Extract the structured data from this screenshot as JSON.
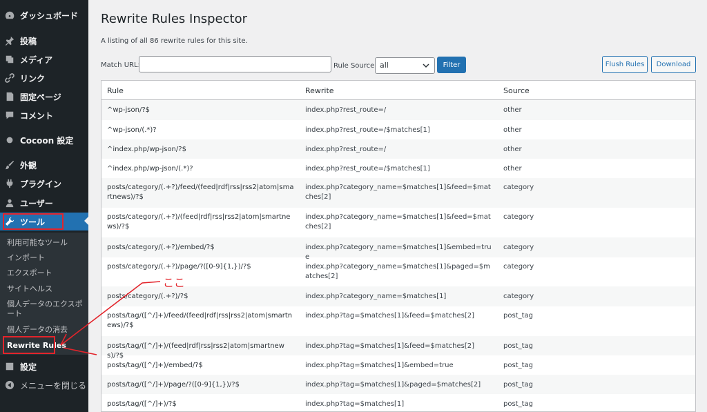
{
  "sidebar": {
    "items": [
      {
        "label": "ダッシュボード",
        "icon": "dashboard-icon"
      },
      {
        "label": "投稿",
        "icon": "pin-icon"
      },
      {
        "label": "メディア",
        "icon": "media-icon"
      },
      {
        "label": "リンク",
        "icon": "link-icon"
      },
      {
        "label": "固定ページ",
        "icon": "page-icon"
      },
      {
        "label": "コメント",
        "icon": "comment-icon"
      },
      {
        "label": "Cocoon 設定",
        "icon": "circle-icon"
      },
      {
        "label": "外観",
        "icon": "brush-icon"
      },
      {
        "label": "プラグイン",
        "icon": "plugin-icon"
      },
      {
        "label": "ユーザー",
        "icon": "user-icon"
      },
      {
        "label": "ツール",
        "icon": "wrench-icon"
      },
      {
        "label": "設定",
        "icon": "settings-icon"
      },
      {
        "label": "メニューを閉じる",
        "icon": "collapse-icon"
      }
    ],
    "submenu": [
      "利用可能なツール",
      "インポート",
      "エクスポート",
      "サイトヘルス",
      "個人データのエクスポート",
      "個人データの消去",
      "Rewrite Rules"
    ]
  },
  "page": {
    "title": "Rewrite Rules Inspector",
    "description": "A listing of all 86 rewrite rules for this site.",
    "match_url_label": "Match URL:",
    "match_url_value": "",
    "rule_source_label": "Rule Source:",
    "rule_source_value": "all",
    "filter_button": "Filter",
    "flush_button": "Flush Rules",
    "download_button": "Download"
  },
  "table": {
    "headers": [
      "Rule",
      "Rewrite",
      "Source"
    ],
    "rows": [
      {
        "rule": "^wp-json/?$",
        "rewrite": "index.php?rest_route=/",
        "source": "other"
      },
      {
        "rule": "^wp-json/(.*)?",
        "rewrite": "index.php?rest_route=/$matches[1]",
        "source": "other"
      },
      {
        "rule": "^index.php/wp-json/?$",
        "rewrite": "index.php?rest_route=/",
        "source": "other"
      },
      {
        "rule": "^index.php/wp-json/(.*)?",
        "rewrite": "index.php?rest_route=/$matches[1]",
        "source": "other"
      },
      {
        "rule": "posts/category/(.+?)/feed/(feed|rdf|rss|rss2|atom|smartnews)/?$",
        "rewrite": "index.php?category_name=$matches[1]&feed=$matches[2]",
        "source": "category"
      },
      {
        "rule": "posts/category/(.+?)/(feed|rdf|rss|rss2|atom|smartnews)/?$",
        "rewrite": "index.php?category_name=$matches[1]&feed=$matches[2]",
        "source": "category"
      },
      {
        "rule": "posts/category/(.+?)/embed/?$",
        "rewrite": "index.php?category_name=$matches[1]&embed=true",
        "source": "category"
      },
      {
        "rule": "posts/category/(.+?)/page/?([0-9]{1,})/?$",
        "rewrite": "index.php?category_name=$matches[1]&paged=$matches[2]",
        "source": "category"
      },
      {
        "rule": "posts/category/(.+?)/?$",
        "rewrite": "index.php?category_name=$matches[1]",
        "source": "category"
      },
      {
        "rule": "posts/tag/([^/]+)/feed/(feed|rdf|rss|rss2|atom|smartnews)/?$",
        "rewrite": "index.php?tag=$matches[1]&feed=$matches[2]",
        "source": "post_tag"
      },
      {
        "rule": "posts/tag/([^/]+)/(feed|rdf|rss|rss2|atom|smartnews)/?$",
        "rewrite": "index.php?tag=$matches[1]&feed=$matches[2]",
        "source": "post_tag"
      },
      {
        "rule": "posts/tag/([^/]+)/embed/?$",
        "rewrite": "index.php?tag=$matches[1]&embed=true",
        "source": "post_tag"
      },
      {
        "rule": "posts/tag/([^/]+)/page/?([0-9]{1,})/?$",
        "rewrite": "index.php?tag=$matches[1]&paged=$matches[2]",
        "source": "post_tag"
      },
      {
        "rule": "posts/tag/([^/]+)/?$",
        "rewrite": "index.php?tag=$matches[1]",
        "source": "post_tag"
      }
    ]
  },
  "annotation": {
    "text": "ここ",
    "color": "#e3242b"
  },
  "colors": {
    "sidebar_bg": "#1d2327",
    "accent": "#2271b1"
  }
}
